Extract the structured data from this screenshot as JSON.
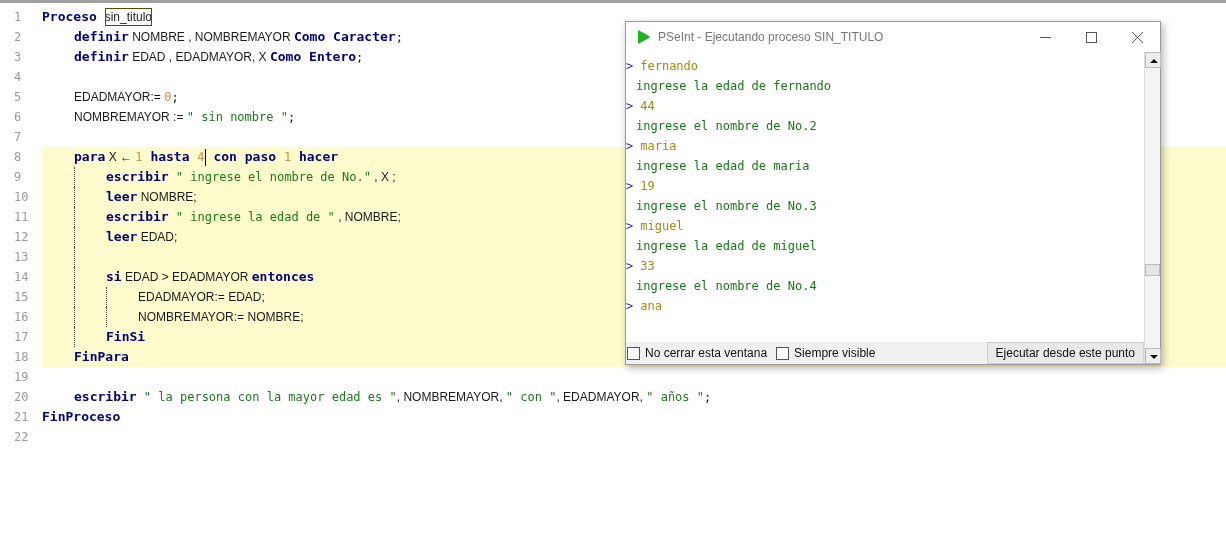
{
  "editor": {
    "lines": [
      {
        "number": "1",
        "highlighted": false,
        "tokens": [
          {
            "kind": "kw",
            "text": "Proceso "
          },
          {
            "kind": "id",
            "text": "sin_titulo",
            "outlined": true
          }
        ],
        "children": [
          {
            "number": "2",
            "highlighted": false,
            "tokens": [
              {
                "kind": "kw",
                "text": "definir"
              },
              {
                "kind": "id",
                "text": " NOMBRE , NOMBREMAYOR "
              },
              {
                "kind": "kw",
                "text": "Como Caracter"
              },
              {
                "kind": "op",
                "text": ";"
              }
            ]
          },
          {
            "number": "3",
            "highlighted": false,
            "tokens": [
              {
                "kind": "kw",
                "text": "definir"
              },
              {
                "kind": "id",
                "text": " EDAD , EDADMAYOR, X "
              },
              {
                "kind": "kw",
                "text": "Como Entero"
              },
              {
                "kind": "op",
                "text": ";"
              }
            ]
          },
          {
            "number": "4",
            "highlighted": false
          },
          {
            "number": "5",
            "highlighted": false,
            "tokens": [
              {
                "kind": "id",
                "text": "EDADMAYOR:= "
              },
              {
                "kind": "num",
                "text": "0"
              },
              {
                "kind": "op",
                "text": ";"
              }
            ]
          },
          {
            "number": "6",
            "highlighted": false,
            "tokens": [
              {
                "kind": "id",
                "text": "NOMBREMAYOR := "
              },
              {
                "kind": "str",
                "text": "\" sin nombre \""
              },
              {
                "kind": "op",
                "text": ";"
              }
            ]
          },
          {
            "number": "7",
            "highlighted": false
          },
          {
            "number": "8",
            "highlighted": true,
            "tokens": [
              {
                "kind": "kw",
                "text": "para"
              },
              {
                "kind": "id",
                "text": " X ← "
              },
              {
                "kind": "num",
                "text": "1"
              },
              {
                "kind": "kw",
                "text": " hasta "
              },
              {
                "kind": "num",
                "text": "4"
              },
              {
                "kind": "caret"
              },
              {
                "kind": "kw",
                "text": " con paso "
              },
              {
                "kind": "num",
                "text": "1"
              },
              {
                "kind": "kw",
                "text": " hacer"
              }
            ],
            "children": [
              {
                "number": "9",
                "highlighted": true,
                "tokens": [
                  {
                    "kind": "kw",
                    "text": "escribir"
                  },
                  {
                    "kind": "str",
                    "text": " \" ingrese el nombre de No.\""
                  },
                  {
                    "kind": "id",
                    "text": " , X ;"
                  }
                ]
              },
              {
                "number": "10",
                "highlighted": true,
                "tokens": [
                  {
                    "kind": "kw",
                    "text": "leer"
                  },
                  {
                    "kind": "id",
                    "text": " NOMBRE;"
                  }
                ]
              },
              {
                "number": "11",
                "highlighted": true,
                "tokens": [
                  {
                    "kind": "kw",
                    "text": "escribir"
                  },
                  {
                    "kind": "str",
                    "text": " \" ingrese la edad de \""
                  },
                  {
                    "kind": "id",
                    "text": " , NOMBRE;"
                  }
                ]
              },
              {
                "number": "12",
                "highlighted": true,
                "tokens": [
                  {
                    "kind": "kw",
                    "text": "leer"
                  },
                  {
                    "kind": "id",
                    "text": " EDAD;"
                  }
                ]
              },
              {
                "number": "13",
                "highlighted": true
              },
              {
                "number": "14",
                "highlighted": true,
                "tokens": [
                  {
                    "kind": "kw",
                    "text": "si"
                  },
                  {
                    "kind": "id",
                    "text": " EDAD > EDADMAYOR "
                  },
                  {
                    "kind": "kw",
                    "text": "entonces"
                  }
                ],
                "children": [
                  {
                    "number": "15",
                    "highlighted": true,
                    "tokens": [
                      {
                        "kind": "id",
                        "text": "EDADMAYOR:= EDAD;"
                      }
                    ]
                  },
                  {
                    "number": "16",
                    "highlighted": true,
                    "tokens": [
                      {
                        "kind": "id",
                        "text": "NOMBREMAYOR:= NOMBRE;"
                      }
                    ]
                  }
                ]
              },
              {
                "number": "17",
                "highlighted": true,
                "tokens": [
                  {
                    "kind": "kw",
                    "text": "FinSi"
                  }
                ]
              }
            ]
          },
          {
            "number": "18",
            "highlighted": true,
            "tokens": [
              {
                "kind": "kw",
                "text": "FinPara"
              }
            ]
          },
          {
            "number": "19",
            "highlighted": false
          },
          {
            "number": "20",
            "highlighted": false,
            "tokens": [
              {
                "kind": "kw",
                "text": "escribir"
              },
              {
                "kind": "str",
                "text": " \" la persona con la mayor edad es \""
              },
              {
                "kind": "id",
                "text": ", NOMBREMAYOR, "
              },
              {
                "kind": "str",
                "text": "\" con \""
              },
              {
                "kind": "id",
                "text": ", EDADMAYOR, "
              },
              {
                "kind": "str",
                "text": "\" años \""
              },
              {
                "kind": "op",
                "text": ";"
              }
            ]
          }
        ]
      },
      {
        "number": "21",
        "highlighted": false,
        "tokens": [
          {
            "kind": "kw",
            "text": "FinProceso"
          }
        ]
      },
      {
        "number": "22",
        "highlighted": false
      }
    ]
  },
  "console": {
    "title": "PSeInt - Ejecutando proceso SIN_TITULO",
    "lines": [
      {
        "kind": "input",
        "prompt": ">",
        "text": "fernando"
      },
      {
        "kind": "output",
        "text": "ingrese la edad de fernando"
      },
      {
        "kind": "input",
        "prompt": ">",
        "text": "44"
      },
      {
        "kind": "output",
        "text": "ingrese el nombre de No.2"
      },
      {
        "kind": "input",
        "prompt": ">",
        "text": "maria"
      },
      {
        "kind": "output",
        "text": "ingrese la edad de maria"
      },
      {
        "kind": "input",
        "prompt": ">",
        "text": "19"
      },
      {
        "kind": "output",
        "text": "ingrese el nombre de No.3"
      },
      {
        "kind": "input",
        "prompt": ">",
        "text": "miguel"
      },
      {
        "kind": "output",
        "text": "ingrese la edad de miguel"
      },
      {
        "kind": "input",
        "prompt": ">",
        "text": "33"
      },
      {
        "kind": "output",
        "text": "ingrese el nombre de No.4"
      },
      {
        "kind": "input",
        "prompt": ">",
        "text": "ana"
      }
    ],
    "options": [
      {
        "label": "No cerrar esta ventana",
        "checked": false
      },
      {
        "label": "Siempre visible",
        "checked": false
      }
    ],
    "button": "Ejecutar desde este punto"
  }
}
